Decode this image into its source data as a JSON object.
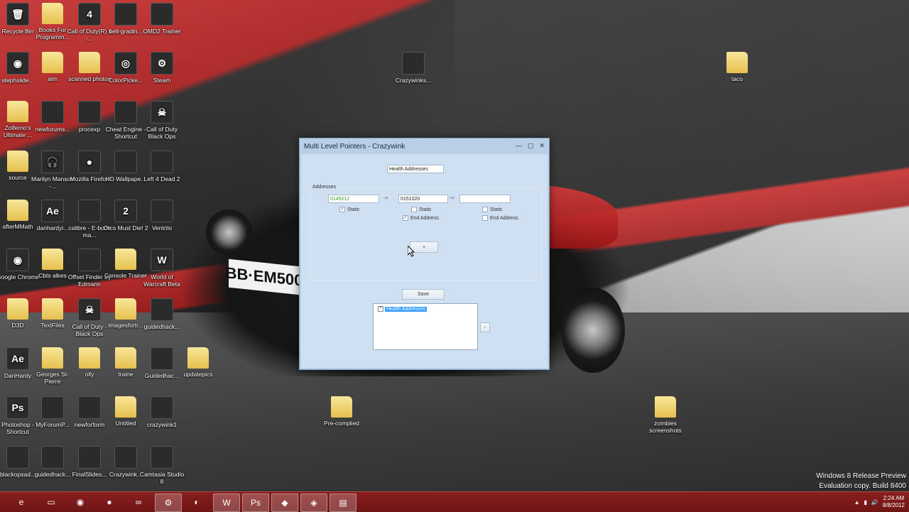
{
  "desktop_icons": [
    {
      "id": "recycle",
      "label": "Recycle Bin",
      "glyph": "🗑",
      "type": "file"
    },
    {
      "id": "books",
      "label": "Books For Programm...",
      "glyph": "",
      "type": "folder"
    },
    {
      "id": "cod4",
      "label": "Call of Duty(R) 4 -...",
      "glyph": "4",
      "type": "file"
    },
    {
      "id": "belt",
      "label": "belt-gradin...",
      "glyph": "",
      "type": "file"
    },
    {
      "id": "omd2",
      "label": "OMD2 Trainer",
      "glyph": "",
      "type": "file"
    },
    {
      "id": "stephslide",
      "label": "stephslide...",
      "glyph": "◉",
      "type": "file"
    },
    {
      "id": "aim",
      "label": "aim",
      "glyph": "",
      "type": "folder"
    },
    {
      "id": "scanned",
      "label": "scanned photos",
      "glyph": "",
      "type": "folder"
    },
    {
      "id": "colorpicker",
      "label": "ColorPicke...",
      "glyph": "◎",
      "type": "file"
    },
    {
      "id": "steam",
      "label": "Steam",
      "glyph": "⚙",
      "type": "file"
    },
    {
      "id": "zolferno",
      "label": "Zolferno's Ultimate ...",
      "glyph": "",
      "type": "folder"
    },
    {
      "id": "newforums",
      "label": "newforums...",
      "glyph": "",
      "type": "file"
    },
    {
      "id": "procexp",
      "label": "procexp",
      "glyph": "",
      "type": "file"
    },
    {
      "id": "cheatengine",
      "label": "Cheat Engine - Shortcut",
      "glyph": "",
      "type": "file"
    },
    {
      "id": "codbo",
      "label": "Call of Duty Black Ops",
      "glyph": "☠",
      "type": "file"
    },
    {
      "id": "source",
      "label": "source",
      "glyph": "",
      "type": "folder"
    },
    {
      "id": "marilyn",
      "label": "Marilyn Manson -...",
      "glyph": "🎧",
      "type": "file"
    },
    {
      "id": "firefox",
      "label": "Mozilla Firefox",
      "glyph": "●",
      "type": "file"
    },
    {
      "id": "hdwall",
      "label": "HD Wallpape...",
      "glyph": "",
      "type": "file"
    },
    {
      "id": "l4d2",
      "label": "Left 4 Dead 2",
      "glyph": "",
      "type": "file"
    },
    {
      "id": "afterm",
      "label": "afterMMath",
      "glyph": "",
      "type": "folder"
    },
    {
      "id": "danhardy",
      "label": "danhardyi...",
      "glyph": "Ae",
      "type": "file"
    },
    {
      "id": "calibre",
      "label": "calibre - E-book ma...",
      "glyph": "",
      "type": "file"
    },
    {
      "id": "orcs",
      "label": "Orcs Must Die! 2",
      "glyph": "2",
      "type": "file"
    },
    {
      "id": "ventrilo",
      "label": "Ventrilo",
      "glyph": "",
      "type": "file"
    },
    {
      "id": "chrome",
      "label": "Google Chrome",
      "glyph": "◉",
      "type": "file"
    },
    {
      "id": "cbtcs",
      "label": "Cbts alkes",
      "glyph": "",
      "type": "folder"
    },
    {
      "id": "offsetfinder",
      "label": "Offset Finder by Edmann",
      "glyph": "",
      "type": "file"
    },
    {
      "id": "console",
      "label": "Console Trainer",
      "glyph": "",
      "type": "folder"
    },
    {
      "id": "wow",
      "label": "World of Warcraft Beta",
      "glyph": "W",
      "type": "file"
    },
    {
      "id": "d3d",
      "label": "D3D",
      "glyph": "",
      "type": "folder"
    },
    {
      "id": "textfiles",
      "label": "TextFiles",
      "glyph": "",
      "type": "folder"
    },
    {
      "id": "codbo2",
      "label": "Call of Duty - Black Ops",
      "glyph": "☠",
      "type": "file"
    },
    {
      "id": "imagesfor",
      "label": "imagesfortr...",
      "glyph": "",
      "type": "folder"
    },
    {
      "id": "guidedhack1",
      "label": "guidedhack...",
      "glyph": "",
      "type": "file"
    },
    {
      "id": "danhardy2",
      "label": "DanHardy",
      "glyph": "Ae",
      "type": "file"
    },
    {
      "id": "gsp",
      "label": "Georges St-Pierre",
      "glyph": "",
      "type": "folder"
    },
    {
      "id": "olly",
      "label": "olly",
      "glyph": "",
      "type": "folder"
    },
    {
      "id": "traine",
      "label": "traine",
      "glyph": "",
      "type": "folder"
    },
    {
      "id": "guidedhac2",
      "label": "Guidedhac...",
      "glyph": "",
      "type": "file"
    },
    {
      "id": "updatepics",
      "label": "updatepics",
      "glyph": "",
      "type": "folder"
    },
    {
      "id": "photoshop",
      "label": "Photoshop - Shortcut",
      "glyph": "Ps",
      "type": "file"
    },
    {
      "id": "myforum",
      "label": "MyForumP...",
      "glyph": "",
      "type": "file"
    },
    {
      "id": "newforform",
      "label": "newforform",
      "glyph": "",
      "type": "file"
    },
    {
      "id": "untitled",
      "label": "Untitled",
      "glyph": "",
      "type": "folder"
    },
    {
      "id": "crazywink1",
      "label": "crazywink1",
      "glyph": "",
      "type": "file"
    },
    {
      "id": "blackops",
      "label": "blackopsad...",
      "glyph": "",
      "type": "file"
    },
    {
      "id": "guidedhack3",
      "label": "guidedhack...",
      "glyph": "",
      "type": "file"
    },
    {
      "id": "finalslides",
      "label": "FinalSlides...",
      "glyph": "",
      "type": "file"
    },
    {
      "id": "crazywink2",
      "label": "Crazywink...",
      "glyph": "",
      "type": "file"
    },
    {
      "id": "camtasia",
      "label": "Camtasia Studio 8",
      "glyph": "",
      "type": "file"
    },
    {
      "id": "crazywinks",
      "label": "Crazywinks...",
      "glyph": "",
      "type": "file"
    },
    {
      "id": "taco",
      "label": "taco",
      "glyph": "",
      "type": "folder"
    },
    {
      "id": "precompiled",
      "label": "Pre-complied",
      "glyph": "",
      "type": "folder"
    },
    {
      "id": "zombies",
      "label": "zombies screenshots",
      "glyph": "",
      "type": "folder"
    }
  ],
  "dialog": {
    "title": "Multi Level Pointers - Crazywink",
    "name_field": "Health Addresses",
    "group_label": "Addresses",
    "addr1": "0145012",
    "addr2": "0151020",
    "addr3": "",
    "arrow": "->",
    "static_label": "Static",
    "end_address_label": "End Address",
    "add_btn": "+",
    "save_btn": "Save",
    "tree_node": "Health Addresses",
    "side_btn": "-"
  },
  "watermark": {
    "line1": "Windows 8 Release Preview",
    "line2": "Evaluation copy. Build 8400"
  },
  "taskbar": {
    "time": "2:24 AM",
    "date": "8/8/2012"
  },
  "colors": {
    "taskbar": "#7a1818",
    "dialog_bg": "#cfe0f2",
    "selection": "#3399ff"
  }
}
